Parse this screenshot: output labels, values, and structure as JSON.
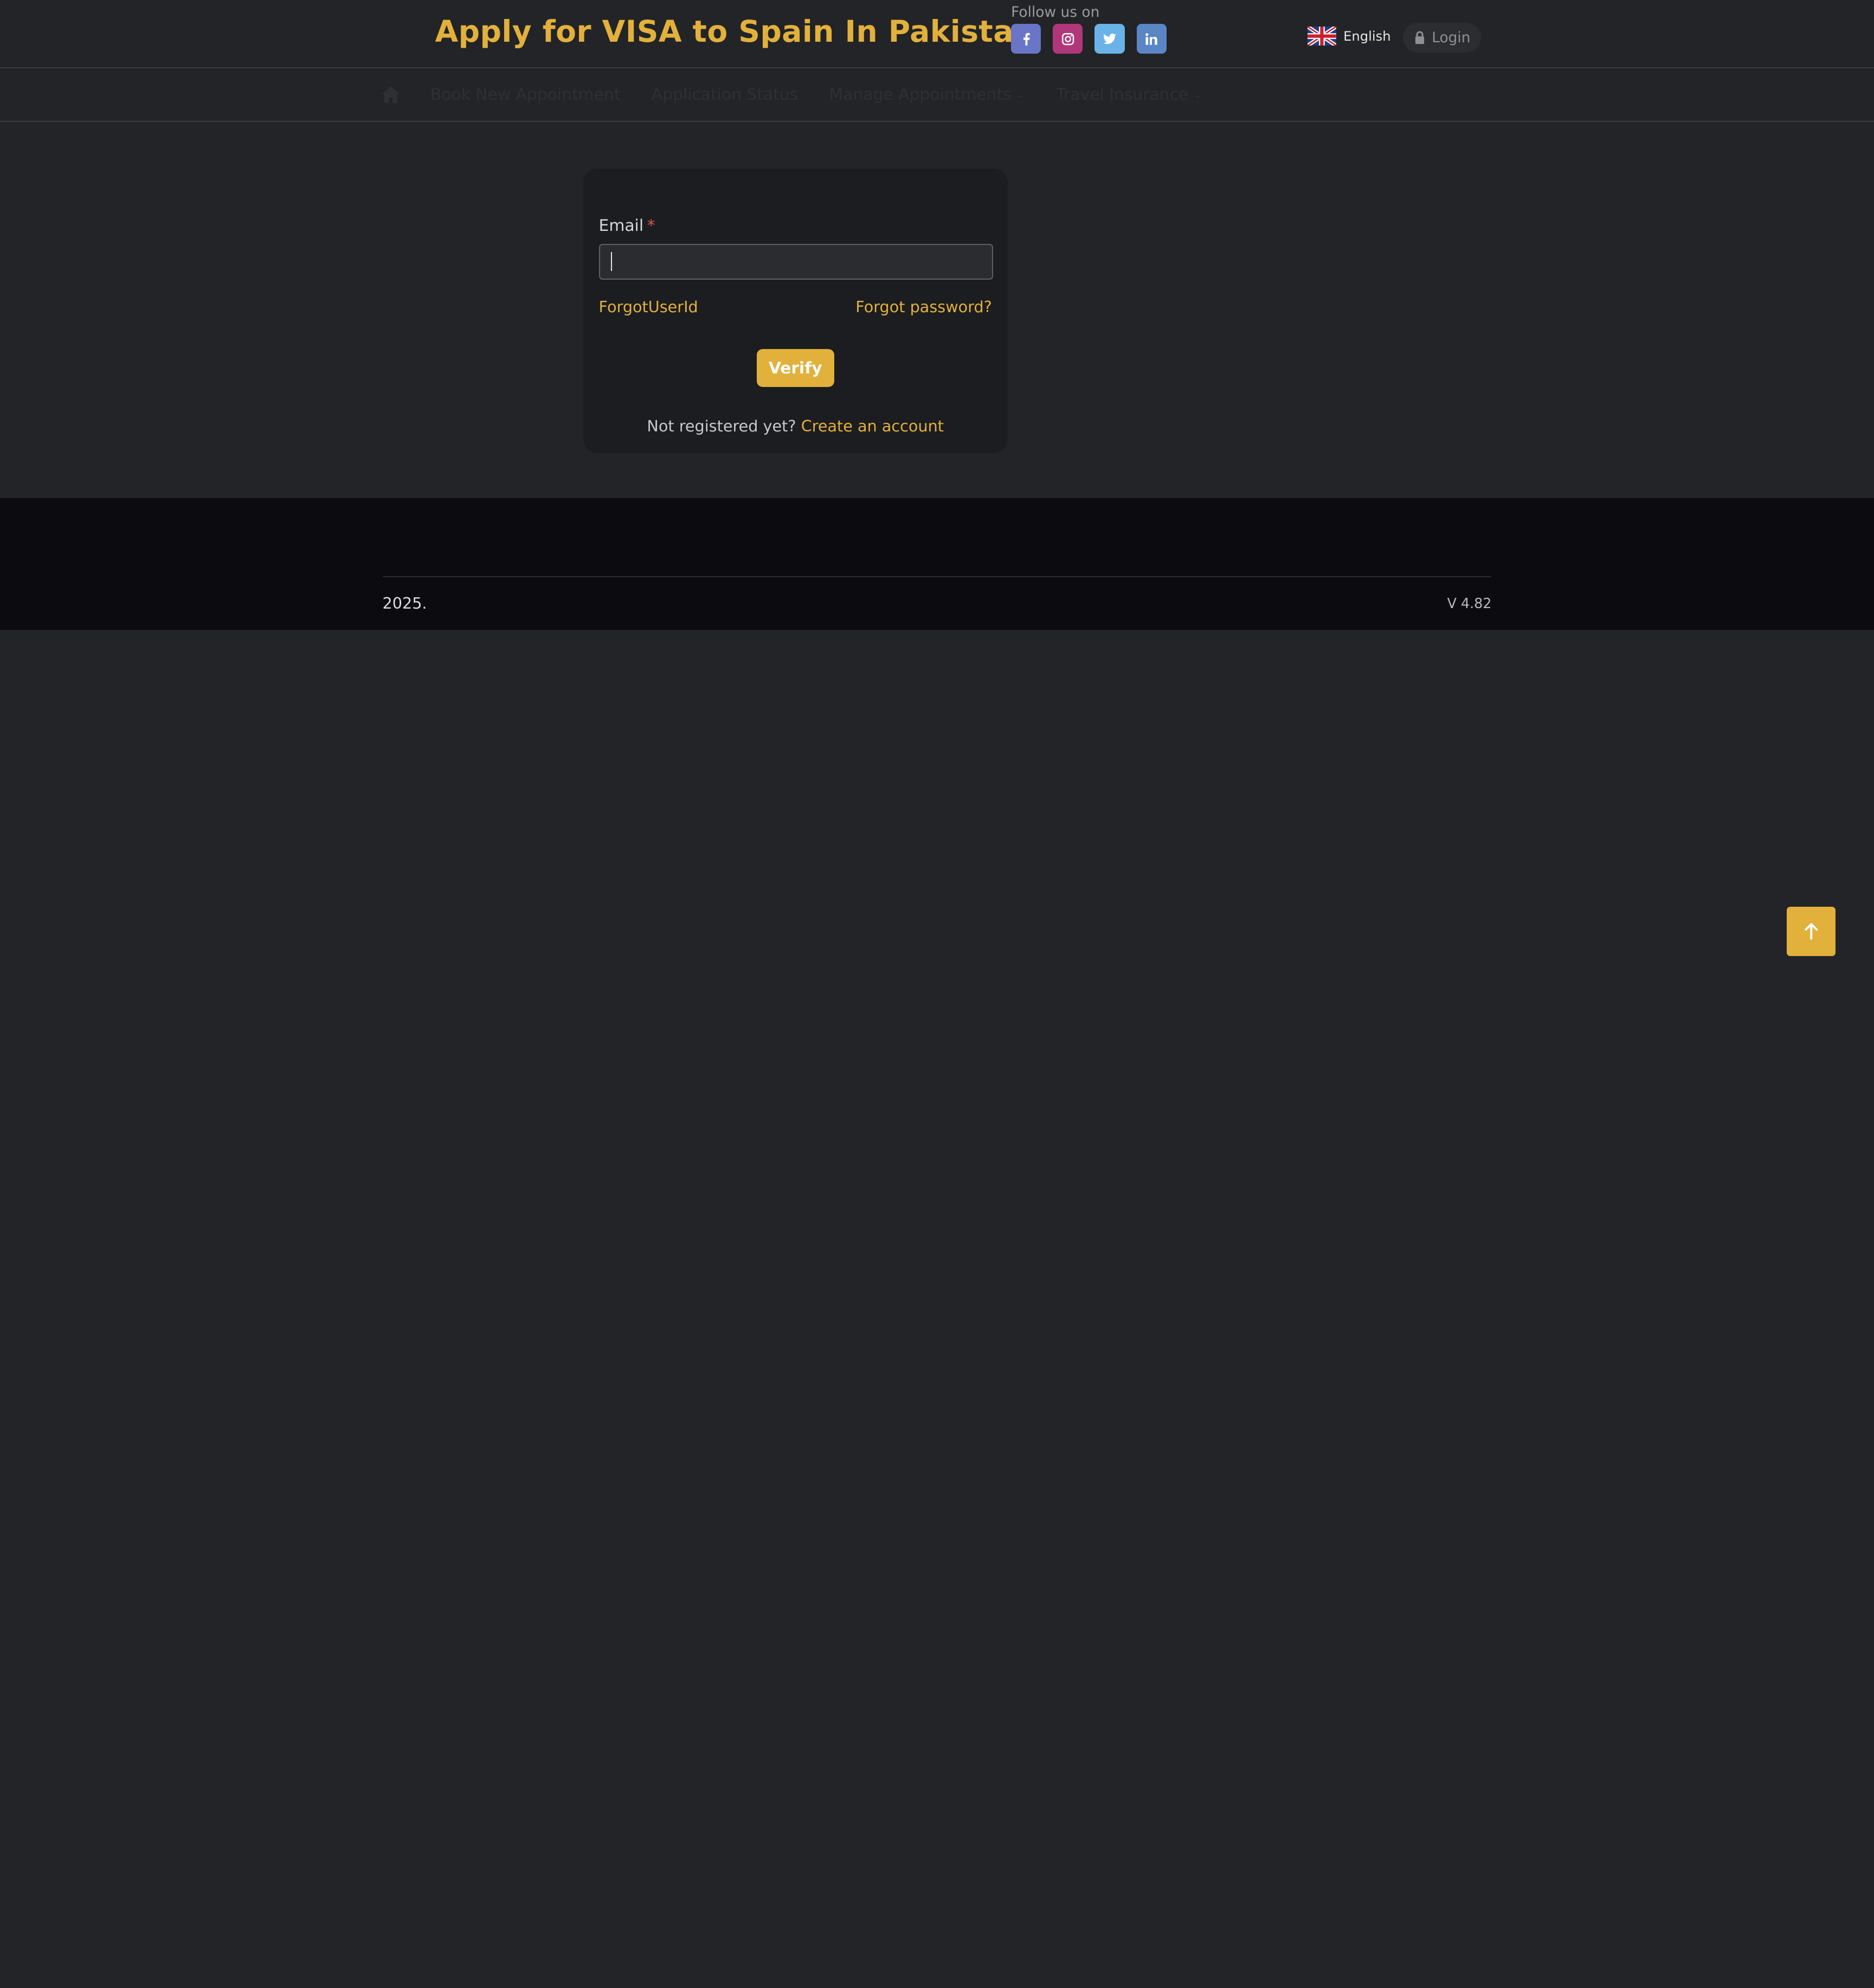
{
  "header": {
    "title": "Apply for VISA to Spain In Pakistan",
    "follow_label": "Follow us on",
    "socials": [
      {
        "name": "facebook-icon",
        "color": "#6a75c8"
      },
      {
        "name": "instagram-icon",
        "color": "#b0387a"
      },
      {
        "name": "twitter-icon",
        "color": "#69b3e8"
      },
      {
        "name": "linkedin-icon",
        "color": "#5a86c5"
      }
    ],
    "language": "English",
    "login_label": "Login"
  },
  "nav": {
    "items": [
      {
        "label": "Book New Appointment",
        "dropdown": false
      },
      {
        "label": "Application Status",
        "dropdown": false
      },
      {
        "label": "Manage Appointments",
        "dropdown": true
      },
      {
        "label": "Travel Insurance",
        "dropdown": true
      }
    ]
  },
  "form": {
    "email_label": "Email",
    "required_mark": "*",
    "email_value": "",
    "forgot_user": "ForgotUserId",
    "forgot_password": "Forgot password?",
    "verify_label": "Verify",
    "register_prompt": "Not registered yet?",
    "register_link": "Create an account"
  },
  "footer": {
    "year": "2025.",
    "version": "V 4.82"
  },
  "colors": {
    "accent": "#e2b13c",
    "background": "#232428",
    "card": "#1c1d20",
    "footer": "#0c0c10"
  }
}
